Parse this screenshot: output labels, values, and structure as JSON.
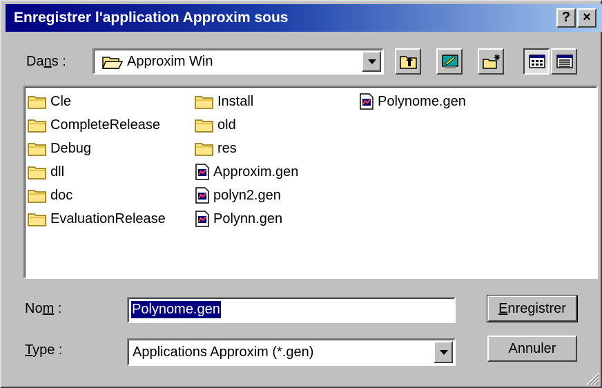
{
  "window": {
    "title": "Enregistrer l'application Approxim sous",
    "help_button": "?",
    "close_button": "×"
  },
  "lookin": {
    "label_pre": "Da",
    "label_accel": "n",
    "label_post": "s :",
    "value": "Approxim Win"
  },
  "files": {
    "column1": [
      {
        "name": "Cle",
        "kind": "folder"
      },
      {
        "name": "CompleteRelease",
        "kind": "folder"
      },
      {
        "name": "Debug",
        "kind": "folder"
      },
      {
        "name": "dll",
        "kind": "folder"
      },
      {
        "name": "doc",
        "kind": "folder"
      },
      {
        "name": "EvaluationRelease",
        "kind": "folder"
      }
    ],
    "column2": [
      {
        "name": "Install",
        "kind": "folder"
      },
      {
        "name": "old",
        "kind": "folder"
      },
      {
        "name": "res",
        "kind": "folder"
      },
      {
        "name": "Approxim.gen",
        "kind": "file"
      },
      {
        "name": "polyn2.gen",
        "kind": "file"
      },
      {
        "name": "Polynn.gen",
        "kind": "file"
      }
    ],
    "column3": [
      {
        "name": "Polynome.gen",
        "kind": "file"
      }
    ]
  },
  "filename": {
    "label_pre": "No",
    "label_accel": "m",
    "label_post": " :",
    "value": "Polynome.gen"
  },
  "filetype": {
    "label_accel": "T",
    "label_post": "ype :",
    "value": "Applications Approxim (*.gen)"
  },
  "buttons": {
    "save_accel": "E",
    "save_rest": "nregistrer",
    "cancel": "Annuler"
  },
  "colors": {
    "titlebar_start": "#000080",
    "titlebar_end": "#a6caf0",
    "selection": "#000080",
    "folder": "#ffe58a"
  }
}
